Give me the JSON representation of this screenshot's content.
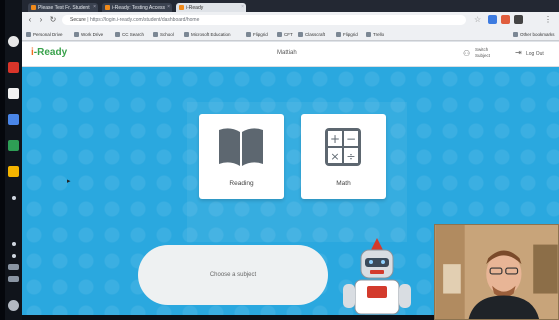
{
  "browser": {
    "tabs": [
      {
        "label": "Please Test Fr. Student",
        "active": false
      },
      {
        "label": "i-Ready: Testing Access",
        "active": false
      },
      {
        "label": "i-Ready",
        "active": true
      }
    ],
    "url_prefix": "Secure",
    "url": "https://login.i-ready.com/student/dashboard/home",
    "bookmarks": [
      "Personal Drive",
      "Work Drive",
      "CC Search",
      "School",
      "Microsoft Education",
      "Flipgrid",
      "CFT",
      "Classcraft",
      "Flipgrid",
      "Trello"
    ],
    "other_bookmarks": "Other bookmarks"
  },
  "app": {
    "logo_prefix": "i",
    "logo_text": "-Ready",
    "student_name": "Mattiah",
    "switch_label_1": "Switch",
    "switch_label_2": "Subject",
    "logout_label": "Log Out",
    "accent_color": "#2aa8df"
  },
  "subjects": [
    {
      "label": "Reading",
      "icon": "book-icon"
    },
    {
      "label": "Math",
      "icon": "calculator-icon"
    }
  ],
  "prompt": "Choose a subject"
}
